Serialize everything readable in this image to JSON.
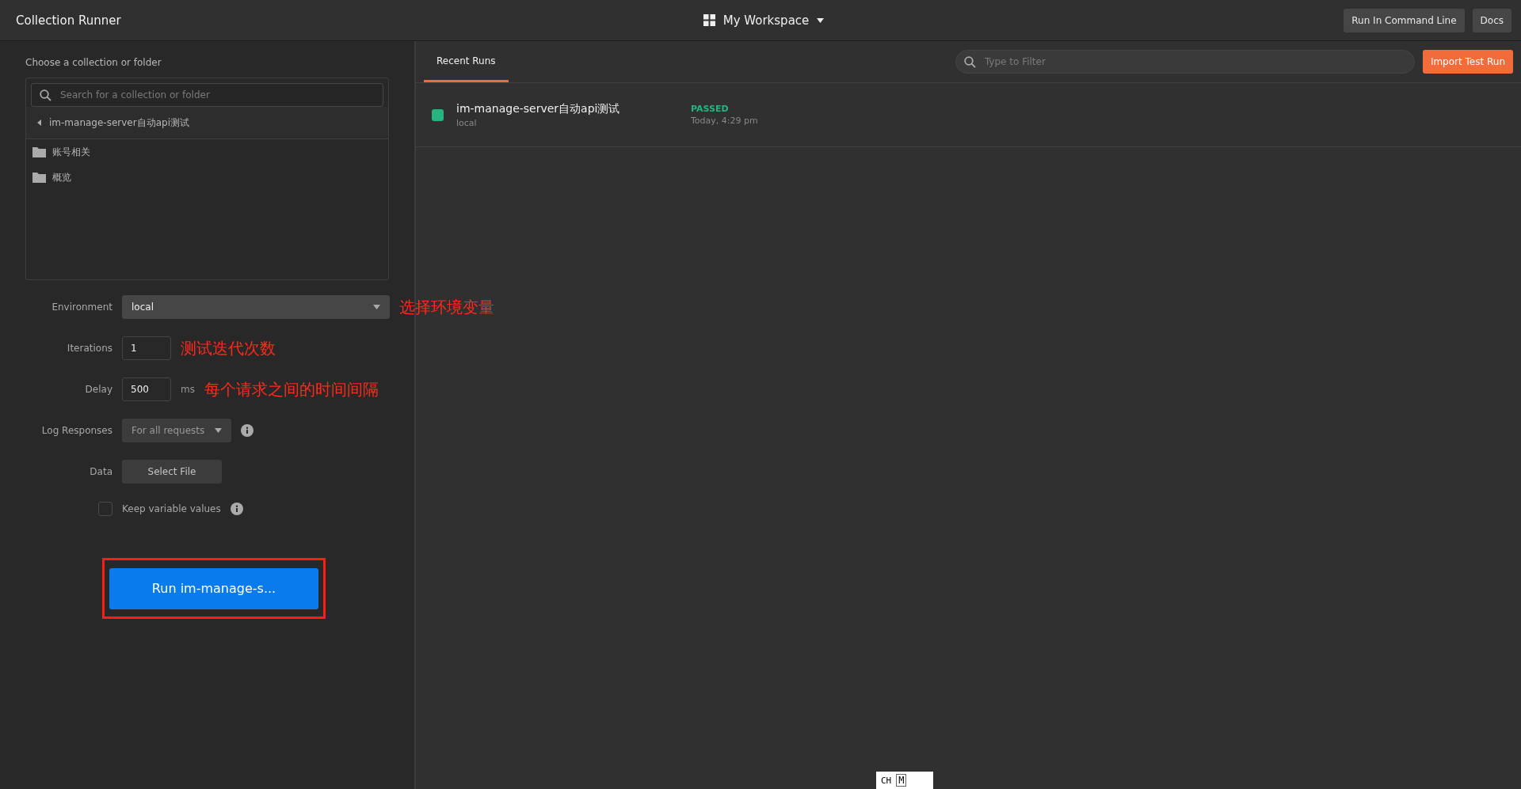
{
  "window": {
    "title": "Collection Runner"
  },
  "workspace": {
    "label": "My Workspace"
  },
  "header_buttons": [
    "Run In Command Line",
    "Docs"
  ],
  "chooser": {
    "label": "Choose a collection or folder",
    "search_placeholder": "Search for a collection or folder",
    "collection": "im-manage-server自动api测试",
    "folders": [
      "账号相关",
      "概览"
    ]
  },
  "form": {
    "rows": [
      {
        "kind": "select",
        "label": "Environment",
        "value": "local",
        "annotation": "选择环境变量"
      },
      {
        "kind": "input",
        "label": "Iterations",
        "value": "1",
        "annotation": "测试迭代次数"
      },
      {
        "kind": "input",
        "label": "Delay",
        "value": "500",
        "unit": "ms",
        "annotation": "每个请求之间的时间间隔"
      },
      {
        "kind": "dropdown",
        "label": "Log Responses",
        "value": "For all requests"
      },
      {
        "kind": "file",
        "label": "Data",
        "value": "Select File"
      },
      {
        "kind": "checkbox",
        "label": "Keep variable values",
        "checked": false
      }
    ]
  },
  "run_button": {
    "label": "Run im-manage-s..."
  },
  "right": {
    "tabs": [
      {
        "label": "Recent Runs",
        "selected": true
      }
    ],
    "filter_placeholder": "Type to Filter",
    "import_button": "Import Test Run",
    "runs": [
      {
        "name": "im-manage-server自动api测试",
        "environment": "local",
        "status": "PASSED",
        "time": "Today, 4:29 pm",
        "color": "#26b47f"
      }
    ]
  },
  "ime": {
    "mode": "CH",
    "key": "M"
  }
}
